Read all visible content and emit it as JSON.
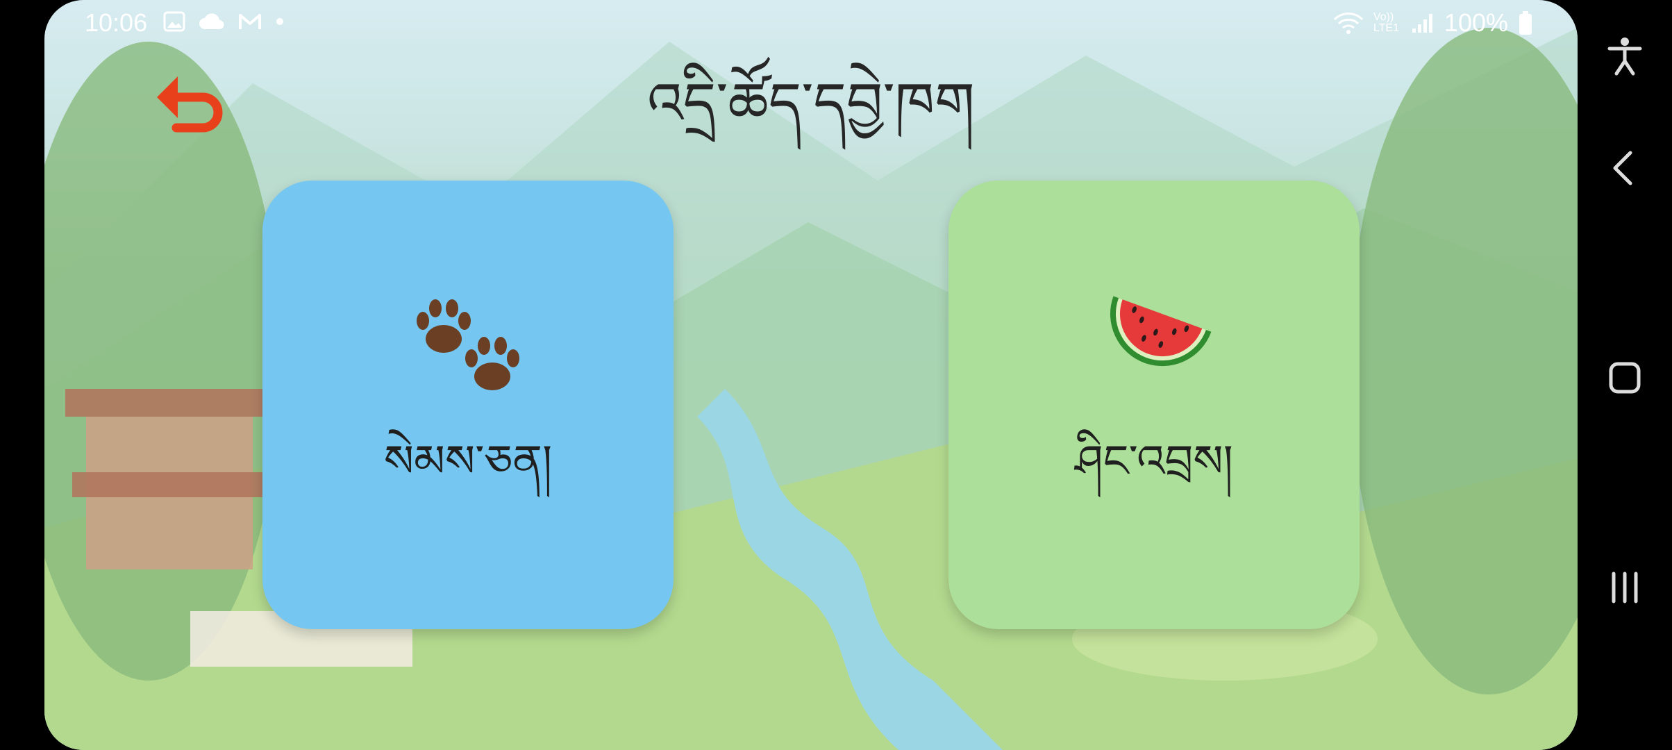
{
  "status_bar": {
    "time": "10:06",
    "battery": "100%",
    "network_label": "Vo)) LTE1"
  },
  "header": {
    "title": "འདྲི་ཚོད་དབྱེ་ཁག",
    "back_icon": "undo-arrow-icon"
  },
  "categories": [
    {
      "label": "སེམས་ཅན།",
      "icon": "paw-prints-icon",
      "color": "#75c7f1"
    },
    {
      "label": "ཤིང་འབྲས།",
      "icon": "watermelon-icon",
      "color": "#acdf99"
    }
  ],
  "nav_bar": {
    "items": [
      "accessibility-icon",
      "back-icon",
      "home-icon",
      "recents-icon"
    ]
  }
}
